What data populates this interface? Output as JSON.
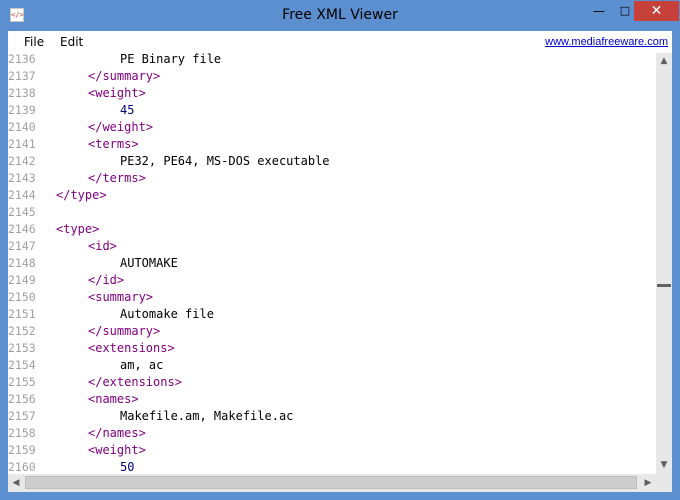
{
  "window": {
    "title": "Free XML Viewer",
    "icon_glyph": "</>",
    "minimize_glyph": "—",
    "maximize_glyph": "□",
    "close_glyph": "✕"
  },
  "menu": {
    "file_label": "File",
    "edit_label": "Edit",
    "website_link": "www.mediafreeware.com"
  },
  "editor": {
    "lines": [
      {
        "n": "2136",
        "indent": 2,
        "kind": "text",
        "content": "PE Binary file"
      },
      {
        "n": "2137",
        "indent": 1,
        "kind": "tag",
        "content": "</summary>"
      },
      {
        "n": "2138",
        "indent": 1,
        "kind": "tag",
        "content": "<weight>"
      },
      {
        "n": "2139",
        "indent": 2,
        "kind": "num",
        "content": "45"
      },
      {
        "n": "2140",
        "indent": 1,
        "kind": "tag",
        "content": "</weight>"
      },
      {
        "n": "2141",
        "indent": 1,
        "kind": "tag",
        "content": "<terms>"
      },
      {
        "n": "2142",
        "indent": 2,
        "kind": "text",
        "content": "PE32, PE64, MS-DOS executable"
      },
      {
        "n": "2143",
        "indent": 1,
        "kind": "tag",
        "content": "</terms>"
      },
      {
        "n": "2144",
        "indent": 0,
        "kind": "tag",
        "content": "</type>"
      },
      {
        "n": "2145",
        "indent": 0,
        "kind": "text",
        "content": ""
      },
      {
        "n": "2146",
        "indent": 0,
        "kind": "tag",
        "content": "<type>"
      },
      {
        "n": "2147",
        "indent": 1,
        "kind": "tag",
        "content": "<id>"
      },
      {
        "n": "2148",
        "indent": 2,
        "kind": "text",
        "content": "AUTOMAKE"
      },
      {
        "n": "2149",
        "indent": 1,
        "kind": "tag",
        "content": "</id>"
      },
      {
        "n": "2150",
        "indent": 1,
        "kind": "tag",
        "content": "<summary>"
      },
      {
        "n": "2151",
        "indent": 2,
        "kind": "text",
        "content": "Automake file"
      },
      {
        "n": "2152",
        "indent": 1,
        "kind": "tag",
        "content": "</summary>"
      },
      {
        "n": "2153",
        "indent": 1,
        "kind": "tag",
        "content": "<extensions>"
      },
      {
        "n": "2154",
        "indent": 2,
        "kind": "text",
        "content": "am, ac"
      },
      {
        "n": "2155",
        "indent": 1,
        "kind": "tag",
        "content": "</extensions>"
      },
      {
        "n": "2156",
        "indent": 1,
        "kind": "tag",
        "content": "<names>"
      },
      {
        "n": "2157",
        "indent": 2,
        "kind": "text",
        "content": "Makefile.am, Makefile.ac"
      },
      {
        "n": "2158",
        "indent": 1,
        "kind": "tag",
        "content": "</names>"
      },
      {
        "n": "2159",
        "indent": 1,
        "kind": "tag",
        "content": "<weight>"
      },
      {
        "n": "2160",
        "indent": 2,
        "kind": "num",
        "content": "50"
      }
    ]
  },
  "scrollbars": {
    "up_glyph": "▲",
    "down_glyph": "▼",
    "left_glyph": "◀",
    "right_glyph": "▶"
  },
  "colors": {
    "title_bar": "#5b8fcf",
    "close_button": "#c7403a",
    "xml_tag": "#800080",
    "xml_number": "#000080",
    "line_number": "#a0a0a0",
    "link": "#0000cc"
  }
}
